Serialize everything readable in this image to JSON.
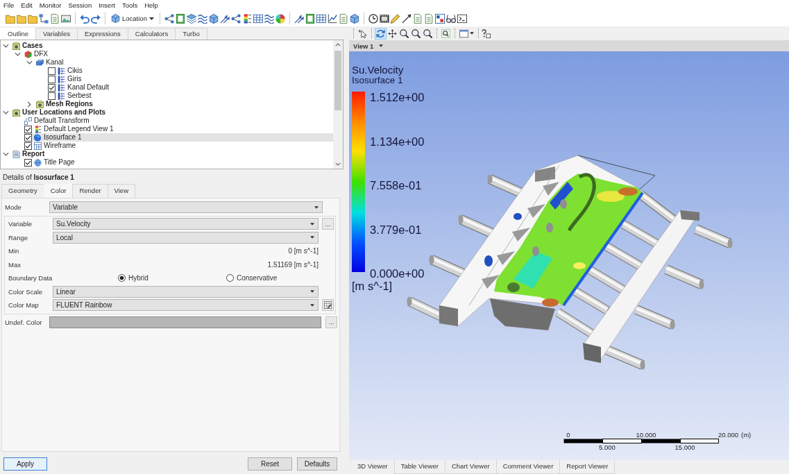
{
  "menu": [
    "File",
    "Edit",
    "Monitor",
    "Session",
    "Insert",
    "Tools",
    "Help"
  ],
  "toolbar": {
    "location_button": "Location"
  },
  "outline": {
    "tabs": [
      {
        "label": "Outline",
        "selected": true
      },
      {
        "label": "Variables",
        "selected": false
      },
      {
        "label": "Expressions",
        "selected": false
      },
      {
        "label": "Calculators",
        "selected": false
      },
      {
        "label": "Turbo",
        "selected": false
      }
    ],
    "tree": [
      {
        "label": "Cases",
        "kind": "group",
        "expanded": true,
        "selected": false,
        "children": [
          {
            "label": "DFX",
            "kind": "case",
            "expanded": true,
            "selected": false,
            "children": [
              {
                "label": "Kanal",
                "kind": "domain",
                "expanded": true,
                "selected": false,
                "children": [
                  {
                    "label": "Cikis",
                    "kind": "boundary",
                    "checked": false,
                    "selected": false
                  },
                  {
                    "label": "Giris",
                    "kind": "boundary",
                    "checked": false,
                    "selected": false
                  },
                  {
                    "label": "Kanal Default",
                    "kind": "boundary",
                    "checked": true,
                    "selected": false
                  },
                  {
                    "label": "Serbest",
                    "kind": "boundary",
                    "checked": false,
                    "selected": false
                  }
                ]
              },
              {
                "label": "Mesh Regions",
                "kind": "group",
                "expanded": false,
                "selected": false
              }
            ]
          }
        ]
      },
      {
        "label": "User Locations and Plots",
        "kind": "group",
        "expanded": true,
        "selected": false,
        "children": [
          {
            "label": "Default Transform",
            "kind": "transform",
            "selected": false
          },
          {
            "label": "Default Legend View 1",
            "kind": "legend",
            "checked": true,
            "selected": false
          },
          {
            "label": "Isosurface 1",
            "kind": "isosurface",
            "checked": true,
            "selected": true
          },
          {
            "label": "Wireframe",
            "kind": "wireframe",
            "checked": true,
            "selected": false
          }
        ]
      },
      {
        "label": "Report",
        "kind": "report",
        "expanded": true,
        "selected": false,
        "children": [
          {
            "label": "Title Page",
            "kind": "page",
            "checked": true,
            "selected": false
          }
        ]
      }
    ]
  },
  "details": {
    "title": "Details of **Isosurface 1**",
    "tabs": [
      {
        "label": "Geometry",
        "selected": false
      },
      {
        "label": "Color",
        "selected": true
      },
      {
        "label": "Render",
        "selected": false
      },
      {
        "label": "View",
        "selected": false
      }
    ],
    "mode": {
      "label": "Mode",
      "value": "Variable"
    },
    "rows": [
      {
        "kind": "dropdown",
        "label": "Variable",
        "value": "Su.Velocity",
        "button": "..."
      },
      {
        "kind": "dropdown",
        "label": "Range",
        "value": "Local"
      },
      {
        "kind": "reading",
        "label": "Min",
        "value": "0 [m s^-1]"
      },
      {
        "kind": "reading",
        "label": "Max",
        "value": "1.51169 [m s^-1]"
      },
      {
        "kind": "radio",
        "label": "Boundary Data",
        "options": [
          {
            "label": "Hybrid",
            "selected": true
          },
          {
            "label": "Conservative",
            "selected": false
          }
        ]
      },
      {
        "kind": "dropdown",
        "label": "Color Scale",
        "value": "Linear"
      },
      {
        "kind": "dropdown",
        "label": "Color Map",
        "value": "FLUENT Rainbow",
        "edit_button": true
      }
    ],
    "undef_color": {
      "label": "Undef. Color",
      "button": "..."
    },
    "buttons": [
      {
        "label": "Apply",
        "focused": true
      },
      {
        "label": "Reset",
        "focused": false
      },
      {
        "label": "Defaults",
        "focused": false
      }
    ]
  },
  "viewer": {
    "tools": [
      {
        "selected": false
      },
      {
        "selected": true
      },
      {
        "selected": false
      },
      {
        "selected": false
      },
      {
        "selected": false
      },
      {
        "selected": false
      },
      {
        "selected": false
      }
    ],
    "view_selector": "View 1",
    "legend": {
      "title": "Su.Velocity",
      "subtitle": "Isosurface 1",
      "ticks": [
        "1.512e+00",
        "1.134e+00",
        "7.558e-01",
        "3.779e-01",
        "0.000e+00"
      ],
      "unit": "[m s^-1]"
    },
    "scale_bar": {
      "top_labels": [
        "0",
        "10.000",
        "20.000"
      ],
      "unit": "(m)",
      "bottom_labels": [
        "5.000",
        "15.000"
      ]
    },
    "tabs": [
      {
        "label": "3D Viewer",
        "selected": true
      },
      {
        "label": "Table Viewer",
        "selected": false
      },
      {
        "label": "Chart Viewer",
        "selected": false
      },
      {
        "label": "Comment Viewer",
        "selected": false
      },
      {
        "label": "Report Viewer",
        "selected": false
      }
    ]
  }
}
